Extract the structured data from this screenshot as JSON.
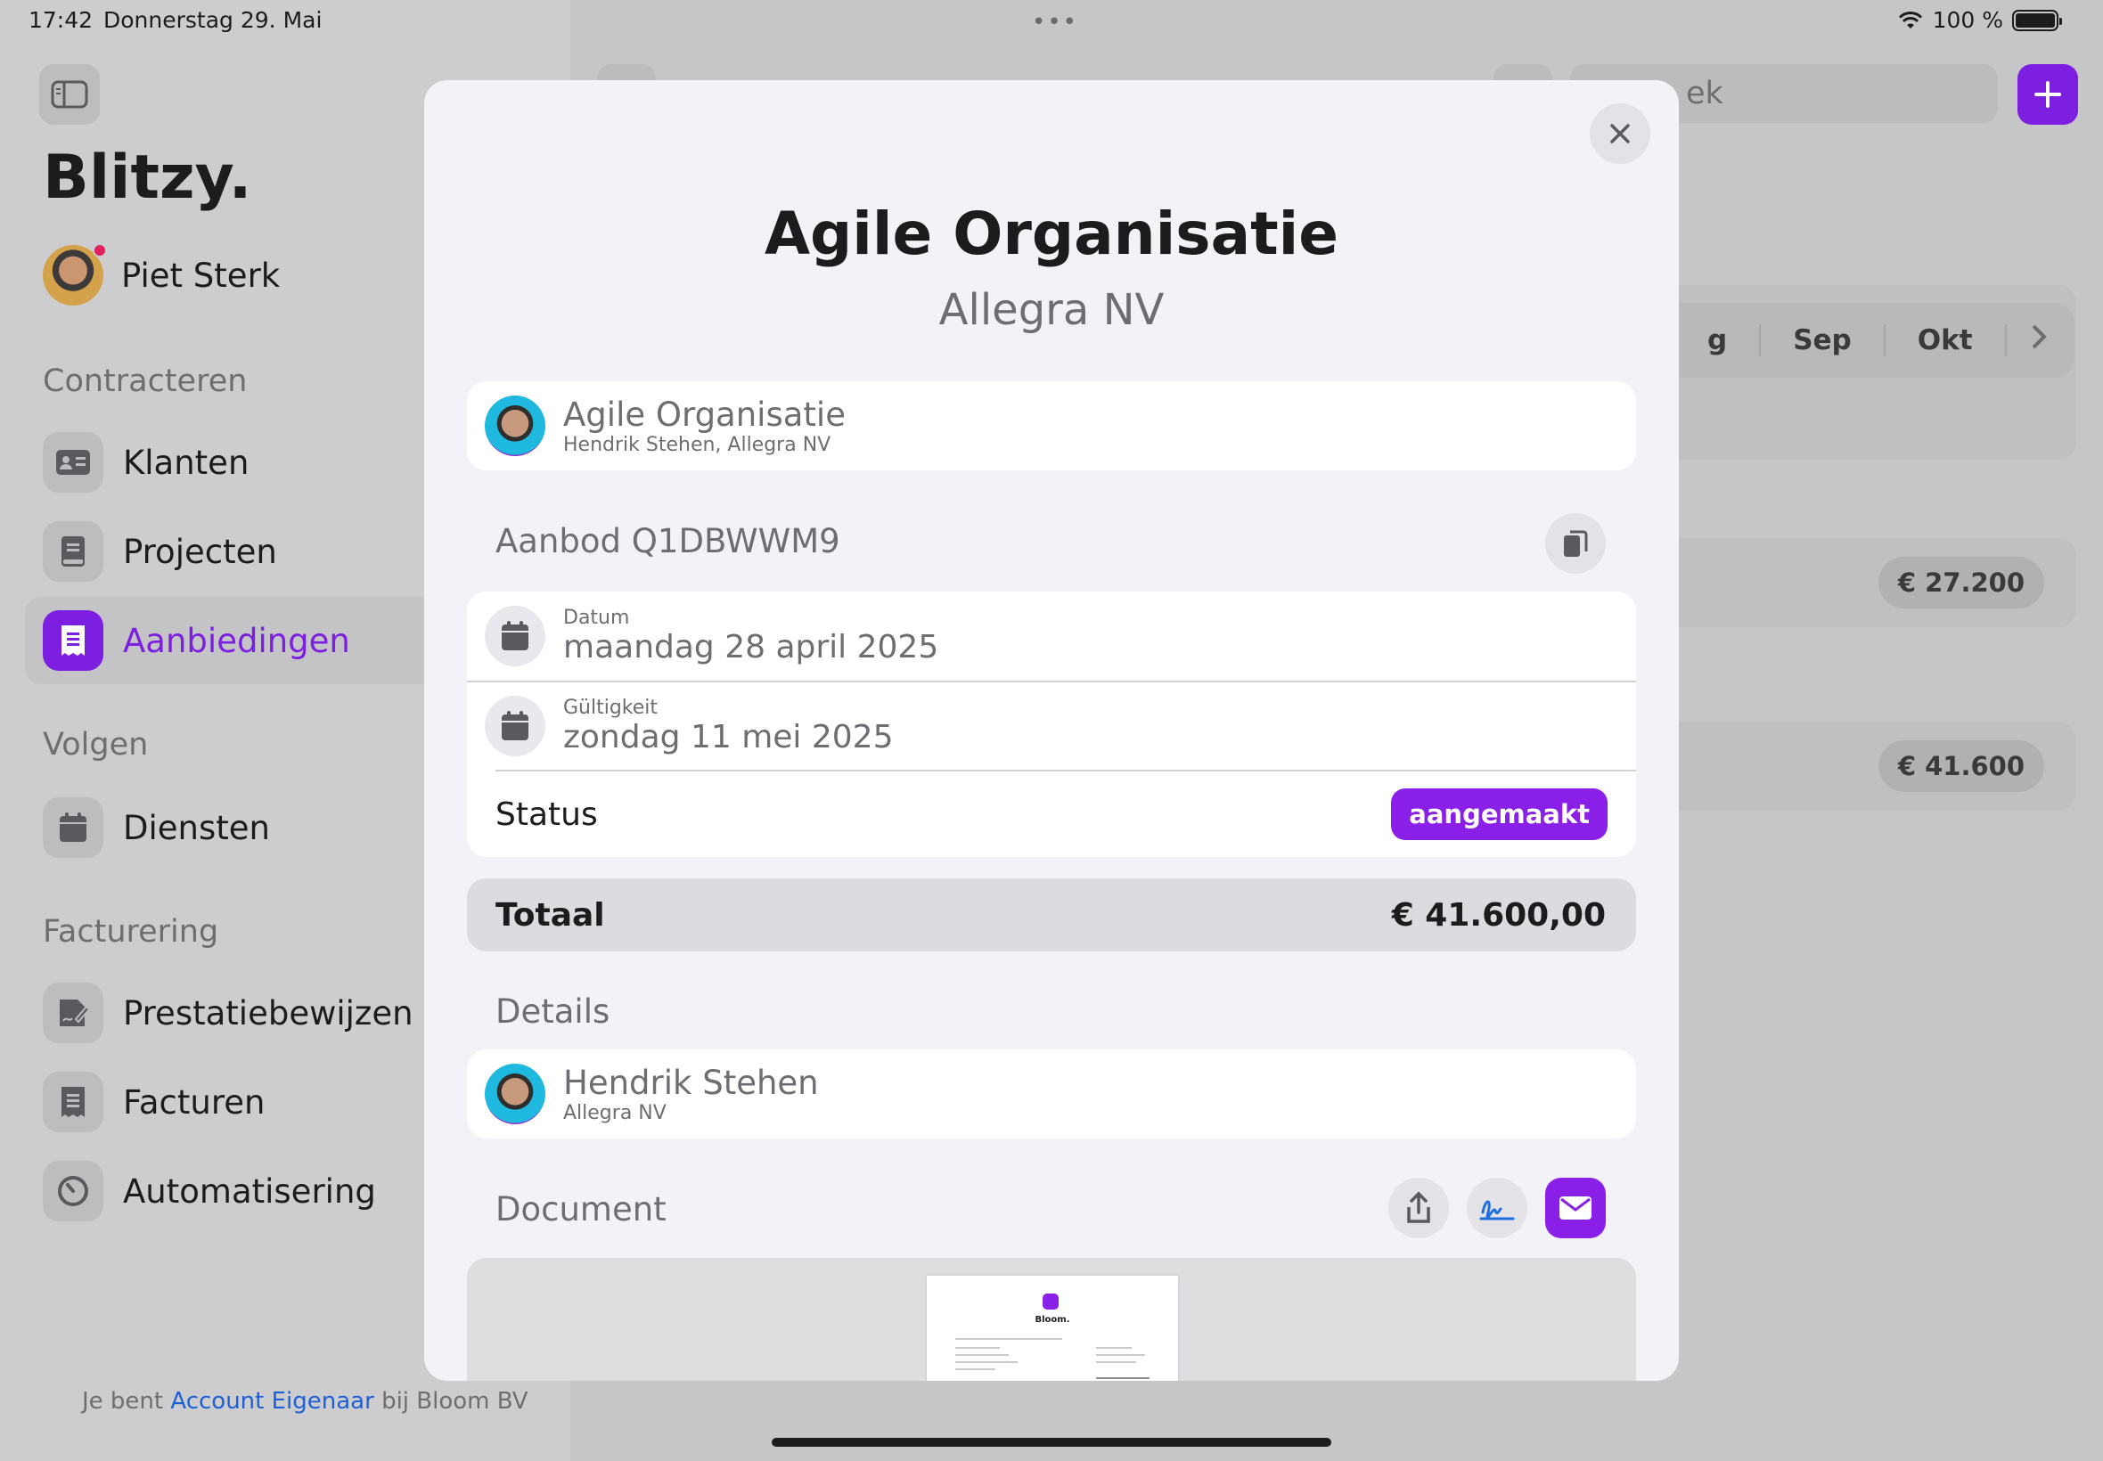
{
  "status_bar": {
    "time": "17:42",
    "date": "Donnerstag 29. Mai",
    "battery": "100 %"
  },
  "sidebar": {
    "brand": "Blitzy.",
    "user_name": "Piet Sterk",
    "sections": [
      {
        "title": "Contracteren",
        "items": [
          {
            "label": "Klanten",
            "icon": "contact-card-icon"
          },
          {
            "label": "Projecten",
            "icon": "book-icon"
          },
          {
            "label": "Aanbiedingen",
            "icon": "receipt-icon",
            "active": true
          }
        ]
      },
      {
        "title": "Volgen",
        "items": [
          {
            "label": "Diensten",
            "icon": "calendar-icon"
          }
        ]
      },
      {
        "title": "Facturering",
        "items": [
          {
            "label": "Prestatiebewijzen",
            "icon": "signed-document-icon"
          },
          {
            "label": "Facturen",
            "icon": "receipt-icon"
          },
          {
            "label": "Automatisering",
            "icon": "timer-icon"
          }
        ]
      }
    ],
    "footer_prefix": "Je bent",
    "footer_link": "Account Eigenaar",
    "footer_suffix": "bij Bloom BV"
  },
  "background": {
    "search_placeholder": "ek",
    "months": [
      "g",
      "Sep",
      "Okt"
    ],
    "amounts": [
      "€ 27.200",
      "€ 41.600"
    ]
  },
  "modal": {
    "title": "Agile Organisatie",
    "subtitle": "Allegra NV",
    "project": {
      "name": "Agile Organisatie",
      "sub": "Hendrik Stehen, Allegra NV"
    },
    "offer_label": "Aanbod Q1DBWWM9",
    "date": {
      "label": "Datum",
      "value": "maandag 28 april 2025"
    },
    "validity": {
      "label": "Gültigkeit",
      "value": "zondag 11 mei 2025"
    },
    "status": {
      "label": "Status",
      "value": "aangemaakt"
    },
    "total": {
      "label": "Totaal",
      "value": "€ 41.600,00"
    },
    "details_label": "Details",
    "contact": {
      "name": "Hendrik Stehen",
      "sub": "Allegra NV"
    },
    "document_label": "Document",
    "doc_preview_brand": "Bloom.",
    "colors": {
      "accent": "#8a1fe8"
    }
  }
}
